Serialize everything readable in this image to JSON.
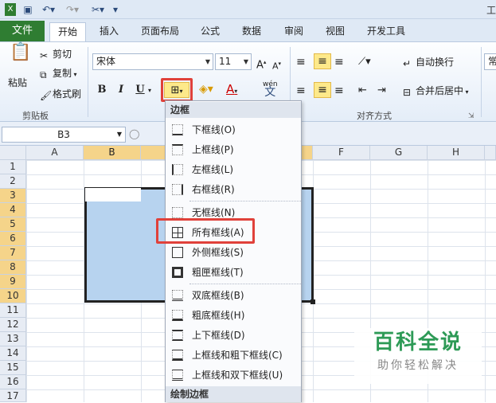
{
  "window": {
    "title_partial": "工"
  },
  "tabs": [
    {
      "label": "文件"
    },
    {
      "label": "开始"
    },
    {
      "label": "插入"
    },
    {
      "label": "页面布局"
    },
    {
      "label": "公式"
    },
    {
      "label": "数据"
    },
    {
      "label": "审阅"
    },
    {
      "label": "视图"
    },
    {
      "label": "开发工具"
    }
  ],
  "clipboard": {
    "paste": "粘贴",
    "cut": "剪切",
    "copy": "复制",
    "format_painter": "格式刷",
    "group": "剪贴板"
  },
  "font": {
    "name": "宋体",
    "size": "11",
    "bold": "B",
    "italic": "I",
    "underline": "U",
    "font_color": "A",
    "phonetic": "wén"
  },
  "alignment": {
    "wrap": "自动换行",
    "merge": "合并后居中",
    "group": "对齐方式"
  },
  "number": {
    "format_partial": "常"
  },
  "namebox": {
    "value": "B3"
  },
  "columns": [
    "A",
    "B",
    "C",
    "D",
    "E",
    "F",
    "G",
    "H"
  ],
  "rows": [
    "1",
    "2",
    "3",
    "4",
    "5",
    "6",
    "7",
    "8",
    "9",
    "10",
    "11",
    "12",
    "13",
    "14",
    "15",
    "16",
    "17"
  ],
  "border_menu": {
    "header": "边框",
    "items": [
      {
        "label": "下框线(O)"
      },
      {
        "label": "上框线(P)"
      },
      {
        "label": "左框线(L)"
      },
      {
        "label": "右框线(R)"
      },
      {
        "label": "无框线(N)"
      },
      {
        "label": "所有框线(A)"
      },
      {
        "label": "外侧框线(S)"
      },
      {
        "label": "粗匣框线(T)"
      },
      {
        "label": "双底框线(B)"
      },
      {
        "label": "粗底框线(H)"
      },
      {
        "label": "上下框线(D)"
      },
      {
        "label": "上框线和粗下框线(C)"
      },
      {
        "label": "上框线和双下框线(U)"
      }
    ],
    "footer": "绘制边框"
  },
  "watermark": {
    "line1": "百科全说",
    "line2": "助你轻松解决"
  },
  "colors": {
    "file_tab": "#2f7d32",
    "highlight": "#e0413a",
    "selection": "#b7d3ef"
  }
}
